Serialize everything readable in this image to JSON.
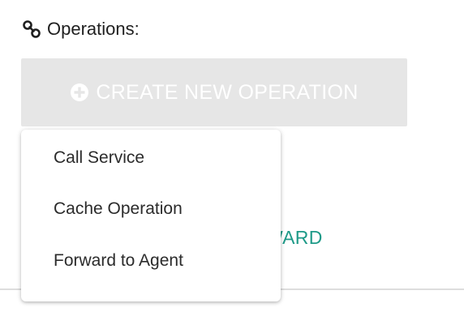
{
  "operations": {
    "title": "Operations:",
    "title_icon": "link-icon"
  },
  "create_button": {
    "label": "CREATE NEW OPERATION",
    "icon": "plus-circle-icon",
    "background": "#e6e6e6",
    "text_color": "#ffffff"
  },
  "forward_link": {
    "label": "WARD",
    "color": "#1e9a88"
  },
  "dropdown": {
    "items": [
      {
        "label": "Call Service"
      },
      {
        "label": "Cache Operation"
      },
      {
        "label": "Forward to Agent"
      }
    ]
  }
}
